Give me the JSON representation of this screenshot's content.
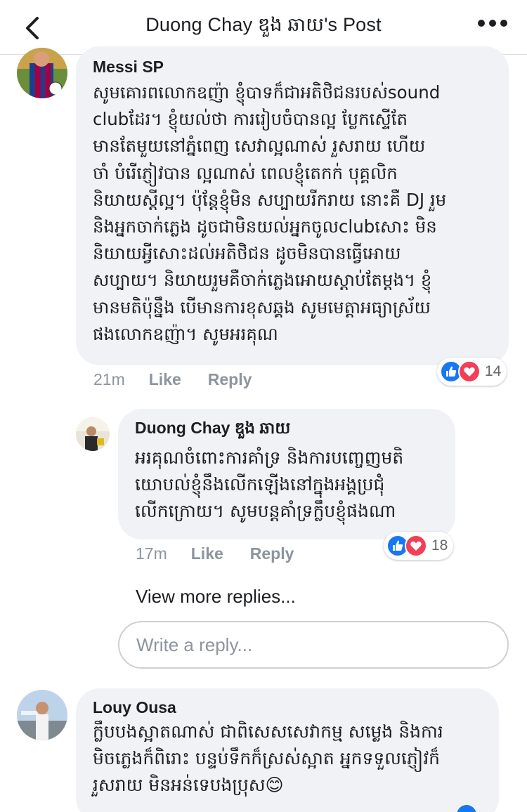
{
  "header": {
    "title": "Duong Chay ឌួង ឆាយ's Post"
  },
  "comments": [
    {
      "author": "Messi SP",
      "text": "សូមគោរពលោកឧញ៉ា ខ្ញុំបាទក៏ជាអតិថិជនរបស់sound\nclubដែរ។ ខ្ញុំយល់ថា ការរៀបចំបានល្អ ប្លែកស្ទើតែ\nមានតែមួយនៅភ្នំពេញ សេវាល្អណាស់ រួសរាយ ហើយ\nចាំ បំរើភ្ញៀវបាន ល្អណាស់ ពេលខ្ញុំតេកក់ បុគ្គលិក\nនិយាយស្ដីល្អ។ ប៉ុន្តែខ្ញុំមិន សប្បាយរីករាយ នោះគឺ DJ រួម\nនិងអ្នកចាក់ភ្លេង ដូចជាមិនយល់អ្នកចូលclubសោះ មិន\nនិយាយអ្វីសោះដល់អតិថិជន ដូចមិនបានធ្វើអោយ\nសប្បាយ។ និយាយរួមគឺចាក់ភ្លេងអោយស្ដាប់តែម្ដង។ ខ្ញុំ\nមានមតិប៉ុន្នឹង បើមានការខុសឆ្គង សូមមេត្តាអធ្យាស្រ័យ\nផងលោកឧញ៉ា។ សូមអរគុណ",
      "time": "21m",
      "like_label": "Like",
      "reply_label": "Reply",
      "reaction_count": "14"
    },
    {
      "author": "Duong Chay ឌួង ឆាយ",
      "text": "អរគុណចំពោះការគាំទ្រ និងការបញ្ចេញមតិ\nយោបល់ខ្ញុំនឹងលើកឡើងនៅក្នុងអង្គប្រជុំ\nលើកក្រោយ។ សូមបន្តគាំទ្រក្លឹបខ្ញុំផងណា",
      "time": "17m",
      "like_label": "Like",
      "reply_label": "Reply",
      "reaction_count": "18"
    },
    {
      "author": "Louy Ousa",
      "text": "ក្លឹបបងស្អាតណាស់ ជាពិសេសសេវាកម្ម សម្លេង និងការ\nមិចភ្លេងក៏ពិរោះ បន្ទប់ទឹកក៏ស្រស់ស្អាត អ្នកទទួលភ្ញៀវក៏\nរួសរាយ មិនអន់ទេបងប្រុស",
      "emoji": "😊"
    }
  ],
  "view_more_label": "View more replies...",
  "reply_input": {
    "placeholder": "Write a reply..."
  },
  "icons": {
    "back": "chevron-left-icon",
    "more": "more-dots-icon",
    "like": "thumbs-up-icon",
    "love": "heart-icon"
  },
  "colors": {
    "like": "#1877f2",
    "love": "#f33e58",
    "bubble": "#f0f2f5",
    "meta_text": "#8d949e"
  }
}
